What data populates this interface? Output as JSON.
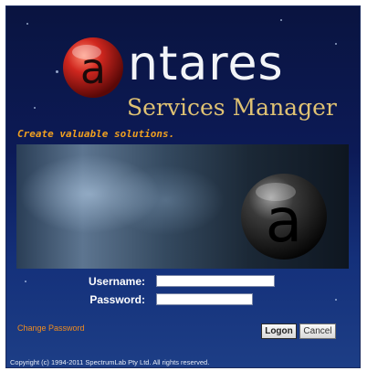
{
  "brand": {
    "logo_letter": "a",
    "wordmark": "ntares",
    "subtitle": "Services Manager",
    "tagline": "Create valuable solutions."
  },
  "login": {
    "username_label": "Username:",
    "password_label": "Password:",
    "username_value": "",
    "password_value": ""
  },
  "actions": {
    "change_password": "Change Password",
    "logon": "Logon",
    "cancel": "Cancel"
  },
  "footer": {
    "copyright": "Copyright (c) 1994-2011 SpectrumLab Pty Ltd. All rights reserved."
  },
  "colors": {
    "tagline": "#f0a020",
    "subtitle": "#e0c273",
    "link": "#f08c1e",
    "background": "#0c1a56"
  }
}
